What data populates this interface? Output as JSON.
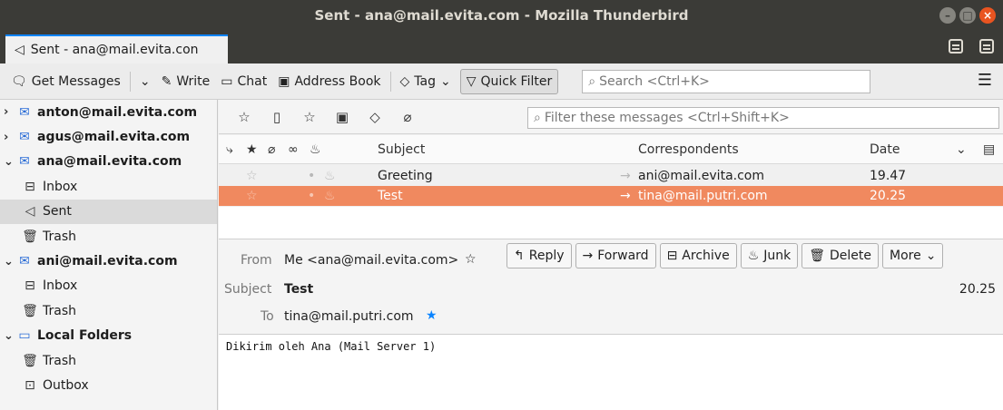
{
  "window": {
    "title": "Sent - ana@mail.evita.com - Mozilla Thunderbird",
    "controls": [
      "–",
      "□",
      "×"
    ]
  },
  "tab": {
    "label": "Sent - ana@mail.evita.con"
  },
  "toolbar": {
    "get_messages": "Get Messages",
    "write": "Write",
    "chat": "Chat",
    "address_book": "Address Book",
    "tag": "Tag",
    "quick_filter": "Quick Filter",
    "search_placeholder": "Search <Ctrl+K>"
  },
  "folders": [
    {
      "type": "account",
      "label": "anton@mail.evita.com",
      "expanded": false
    },
    {
      "type": "account",
      "label": "agus@mail.evita.com",
      "expanded": false
    },
    {
      "type": "account",
      "label": "ana@mail.evita.com",
      "expanded": true
    },
    {
      "type": "folder",
      "label": "Inbox",
      "icon": "inbox-icon"
    },
    {
      "type": "folder",
      "label": "Sent",
      "icon": "sent-icon",
      "selected": true
    },
    {
      "type": "folder",
      "label": "Trash",
      "icon": "trash-icon"
    },
    {
      "type": "account",
      "label": "ani@mail.evita.com",
      "expanded": true
    },
    {
      "type": "folder",
      "label": "Inbox",
      "icon": "inbox-icon"
    },
    {
      "type": "folder",
      "label": "Trash",
      "icon": "trash-icon"
    },
    {
      "type": "local",
      "label": "Local Folders",
      "expanded": true
    },
    {
      "type": "folder",
      "label": "Trash",
      "icon": "trash-icon"
    },
    {
      "type": "folder",
      "label": "Outbox",
      "icon": "outbox-icon"
    }
  ],
  "filter": {
    "placeholder": "Filter these messages <Ctrl+Shift+K>"
  },
  "columns": {
    "subject": "Subject",
    "correspondents": "Correspondents",
    "date": "Date"
  },
  "messages": [
    {
      "subject": "Greeting",
      "correspondent": "ani@mail.evita.com",
      "date": "19.47",
      "selected": false
    },
    {
      "subject": "Test",
      "correspondent": "tina@mail.putri.com",
      "date": "20.25",
      "selected": true
    }
  ],
  "preview": {
    "from_label": "From",
    "from_value": "Me <ana@mail.evita.com>",
    "subject_label": "Subject",
    "subject_value": "Test",
    "to_label": "To",
    "to_value": "tina@mail.putri.com",
    "date": "20.25",
    "actions": {
      "reply": "Reply",
      "forward": "Forward",
      "archive": "Archive",
      "junk": "Junk",
      "delete": "Delete",
      "more": "More"
    },
    "body": "Dikirim oleh Ana (Mail Server 1)"
  },
  "colors": {
    "accent": "#0a84ff",
    "selection": "#f0895f",
    "titlebar": "#3b3b37",
    "close": "#e95420"
  }
}
